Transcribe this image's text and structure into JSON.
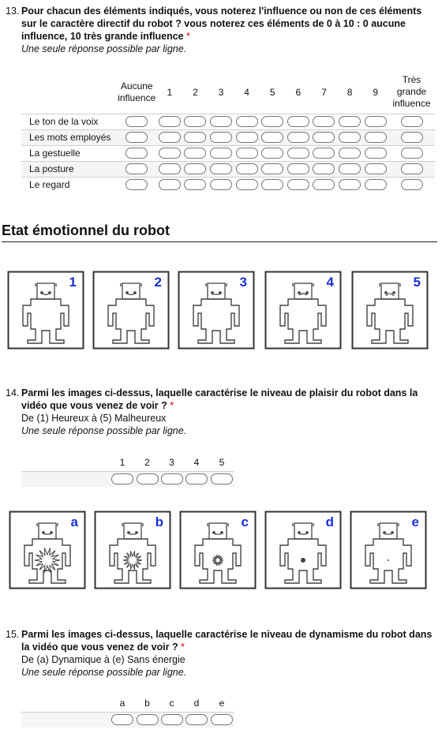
{
  "q13": {
    "number": "13.",
    "title": "Pour chacun des éléments indiqués, vous noterez l'influence ou non de ces éléments sur le caractère directif du robot ? vous noterez ces éléments de 0 à 10 : 0 aucune influence, 10 très grande influence",
    "required_mark": "*",
    "help": "Une seule réponse possible par ligne.",
    "columns": [
      {
        "label": "Aucune influence"
      },
      {
        "label": "1"
      },
      {
        "label": "2"
      },
      {
        "label": "3"
      },
      {
        "label": "4"
      },
      {
        "label": "5"
      },
      {
        "label": "6"
      },
      {
        "label": "7"
      },
      {
        "label": "8"
      },
      {
        "label": "9"
      },
      {
        "label": "Très grande influence"
      }
    ],
    "rows": [
      {
        "label": "Le ton de la voix"
      },
      {
        "label": "Les mots employés"
      },
      {
        "label": "La gestuelle"
      },
      {
        "label": "La posture"
      },
      {
        "label": "Le regard"
      }
    ]
  },
  "section": {
    "title": "Etat émotionnel du robot"
  },
  "images_plaisir": {
    "labels": [
      "1",
      "2",
      "3",
      "4",
      "5"
    ],
    "label_color": "#1a2fd6"
  },
  "q14": {
    "number": "14.",
    "title": "Parmi les images ci-dessus, laquelle caractérise le niveau de plaisir du robot dans la vidéo que vous venez de voir ?",
    "required_mark": "*",
    "subtitle": "De (1) Heureux à (5) Malheureux",
    "help": "Une seule réponse possible par ligne.",
    "columns": [
      "1",
      "2",
      "3",
      "4",
      "5"
    ]
  },
  "images_dynamisme": {
    "labels": [
      "a",
      "b",
      "c",
      "d",
      "e"
    ],
    "label_color": "#1a2fd6"
  },
  "q15": {
    "number": "15.",
    "title": "Parmi les images ci-dessus, laquelle caractérise le niveau de dynamisme du robot dans la vidéo que vous venez de voir ?",
    "required_mark": "*",
    "subtitle": "De (a) Dynamique à (e) Sans énergie",
    "help": "Une seule réponse possible par ligne.",
    "columns": [
      "a",
      "b",
      "c",
      "d",
      "e"
    ]
  }
}
